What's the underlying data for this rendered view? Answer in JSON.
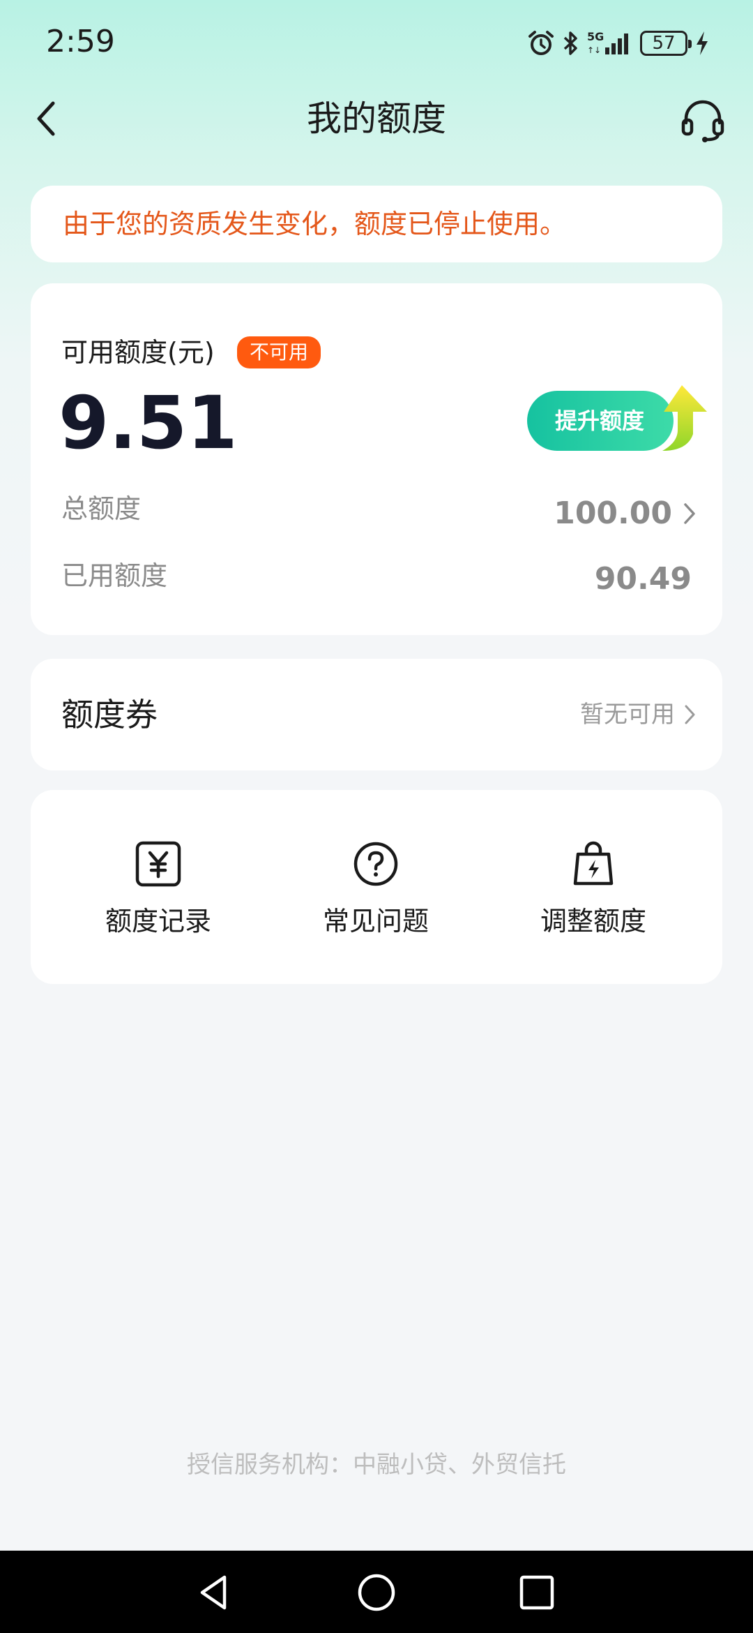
{
  "status_bar": {
    "time": "2:59",
    "network": "5G",
    "battery": "57"
  },
  "nav": {
    "title": "我的额度"
  },
  "notice": {
    "text": "由于您的资质发生变化，额度已停止使用。"
  },
  "quota": {
    "available_label": "可用额度(元)",
    "status_badge": "不可用",
    "available_value": "9.51",
    "raise_button": "提升额度",
    "total_label": "总额度",
    "total_value": "100.00",
    "used_label": "已用额度",
    "used_value": "90.49"
  },
  "coupon": {
    "title": "额度券",
    "status": "暂无可用"
  },
  "shortcuts": [
    {
      "label": "额度记录",
      "icon": "yuan-record-icon"
    },
    {
      "label": "常见问题",
      "icon": "question-circle-icon"
    },
    {
      "label": "调整额度",
      "icon": "bolt-bag-icon"
    }
  ],
  "footer": {
    "text": "授信服务机构：中融小贷、外贸信托"
  },
  "colors": {
    "accent_green": "#16c2a0",
    "warning_orange": "#e4571a",
    "badge_orange": "#ff5a0f"
  }
}
